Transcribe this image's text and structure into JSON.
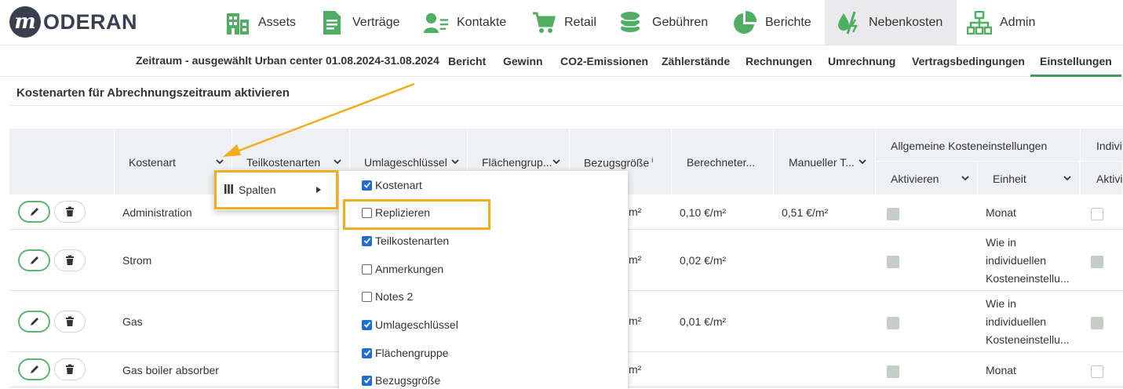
{
  "brand": {
    "name": "ODERAN",
    "initial": "m"
  },
  "nav": [
    {
      "label": "Assets",
      "icon": "building-icon"
    },
    {
      "label": "Verträge",
      "icon": "document-icon"
    },
    {
      "label": "Kontakte",
      "icon": "contact-icon"
    },
    {
      "label": "Retail",
      "icon": "cart-icon"
    },
    {
      "label": "Gebühren",
      "icon": "coins-icon"
    },
    {
      "label": "Berichte",
      "icon": "pie-chart-icon"
    },
    {
      "label": "Nebenkosten",
      "icon": "utility-icon",
      "active": true
    },
    {
      "label": "Admin",
      "icon": "org-chart-icon"
    }
  ],
  "subnav": {
    "period": "Zeitraum - ausgewählt Urban center 01.08.2024-31.08.2024",
    "tabs": [
      "Bericht",
      "Gewinn",
      "CO2-Emissionen",
      "Zählerstände",
      "Rechnungen",
      "Umrechnung",
      "Vertragsbedingungen",
      "Einstellungen"
    ],
    "active_tab": "Einstellungen"
  },
  "section_title": "Kostenarten für Abrechnungszeitraum aktivieren",
  "table": {
    "headers": {
      "kostenart": "Kostenart",
      "teilkostenarten": "Teilkostenarten",
      "umlageschluessel": "Umlageschlüssel",
      "flaechengruppe": "Flächengrup...",
      "bezugsgroesse": "Bezugsgröße",
      "bezugsgroesse_sup": "i",
      "berechneter": "Berechneter...",
      "manueller": "Manueller T...",
      "allgemeine": "Allgemeine Kosteneinstellungen",
      "aktivieren": "Aktivieren",
      "einheit": "Einheit",
      "individuelle": "Indivi",
      "individuelle_aktiv": "Aktivi"
    },
    "rows": [
      {
        "kostenart": "Administration",
        "bezug": "m²",
        "berechnet": "0,10 €/m²",
        "manuell": "0,51 €/m²",
        "aktiv": true,
        "einheit": [
          "Monat"
        ],
        "indiv": false
      },
      {
        "kostenart": "Strom",
        "bezug": "m²",
        "berechnet": "0,02 €/m²",
        "manuell": "",
        "aktiv": true,
        "einheit": [
          "Wie in",
          "individuellen",
          "Kosteneinstellu..."
        ],
        "indiv": true
      },
      {
        "kostenart": "Gas",
        "bezug": "m²",
        "berechnet": "0,01 €/m²",
        "manuell": "",
        "aktiv": true,
        "einheit": [
          "Wie in",
          "individuellen",
          "Kosteneinstellu..."
        ],
        "indiv": true
      },
      {
        "kostenart": "Gas boiler absorber",
        "bezug": "m²",
        "berechnet": "",
        "manuell": "",
        "aktiv": true,
        "einheit": [
          "Monat"
        ],
        "indiv": false
      }
    ]
  },
  "column_menu": {
    "label": "Spalten",
    "options": [
      {
        "label": "Kostenart",
        "checked": true
      },
      {
        "label": "Replizieren",
        "checked": false
      },
      {
        "label": "Teilkostenarten",
        "checked": true
      },
      {
        "label": "Anmerkungen",
        "checked": false
      },
      {
        "label": "Notes 2",
        "checked": false
      },
      {
        "label": "Umlageschlüssel",
        "checked": true
      },
      {
        "label": "Flächengruppe",
        "checked": true
      },
      {
        "label": "Bezugsgröße",
        "checked": true
      }
    ]
  },
  "colors": {
    "accent_green": "#3e9e5a",
    "highlight": "#f0ad1e",
    "checkbox_blue": "#1f6fd0"
  }
}
